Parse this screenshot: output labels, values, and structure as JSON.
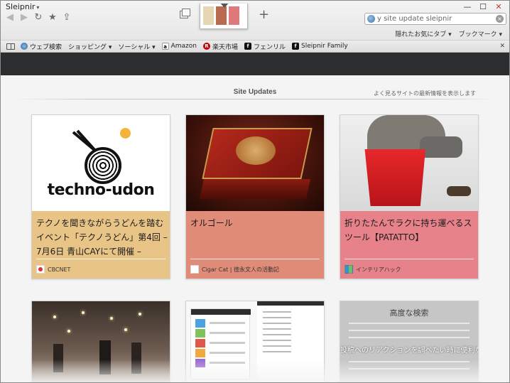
{
  "app": {
    "title": "Sleipnir"
  },
  "nav": {
    "back": "◀",
    "forward": "▶",
    "reload": "↻",
    "favorite": "★",
    "share": "⇪"
  },
  "tabs": {
    "new_tab": "+"
  },
  "search": {
    "value": "y site update sleipnir"
  },
  "window_controls": {
    "minimize": "—",
    "maximize": "☐",
    "close": "✕"
  },
  "top_menu": {
    "hidden_tabs": "隠れたお気にタブ ▾",
    "bookmarks": "ブックマーク ▾"
  },
  "favbar": {
    "items": [
      {
        "label": "ウェブ検索",
        "icon": "globe-icon"
      },
      {
        "label": "ショッピング ▾",
        "icon": ""
      },
      {
        "label": "ソーシャル ▾",
        "icon": ""
      },
      {
        "label": "Amazon",
        "icon": "amazon-icon"
      },
      {
        "label": "楽天市場",
        "icon": "rakuten-icon"
      },
      {
        "label": "フェンリル",
        "icon": "fenrir-icon"
      },
      {
        "label": "Sleipnir Family",
        "icon": "sleipnir-icon"
      }
    ]
  },
  "content": {
    "title": "Site Updates",
    "subtitle": "よく見るサイトの最新情報を表示します"
  },
  "cards": [
    {
      "title": "テクノを聞きながらうどんを踏むイベント「テクノうどん」第4回 – 7月6日 青山CAYにて開催 –",
      "source": "CBCNET",
      "thumb_text": "techno-udon",
      "color": "#e8c487"
    },
    {
      "title": "オルゴール",
      "source": "Cigar Cat | 徳永文人の活動記",
      "color": "#e08c78"
    },
    {
      "title": "折りたたんでラクに持ち運べるスツール【PATATTO】",
      "source": "インテリアハック",
      "color": "#e8828a"
    },
    {
      "title": "",
      "source": ""
    },
    {
      "title": "",
      "source": ""
    },
    {
      "title": "",
      "source": "",
      "thumb_title": "高度な検索",
      "thumb_overlay": "投稿へのリアクションを調べたい時に便利な検索"
    }
  ]
}
